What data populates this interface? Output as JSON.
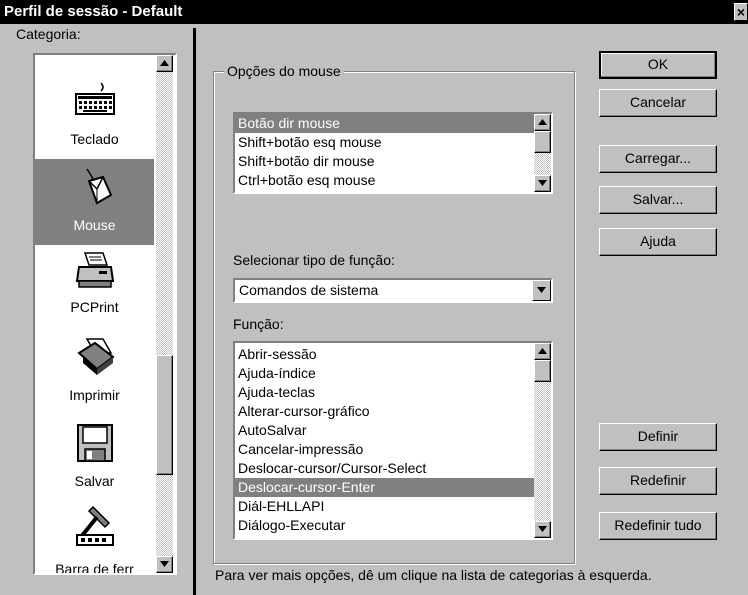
{
  "window": {
    "title": "Perfil de sessão - Default",
    "close_glyph": "×"
  },
  "sidebar": {
    "label": "Categoria:",
    "items": [
      {
        "label": "Teclado",
        "icon": "keyboard-icon"
      },
      {
        "label": "Mouse",
        "icon": "mouse-icon",
        "selected": true
      },
      {
        "label": "PCPrint",
        "icon": "printer-icon"
      },
      {
        "label": "Imprimir",
        "icon": "print-icon"
      },
      {
        "label": "Salvar",
        "icon": "floppy-disk-icon"
      },
      {
        "label": "Barra de ferr",
        "icon": "toolbar-tools-icon"
      }
    ]
  },
  "mouse_options": {
    "group_label": "Opções do mouse",
    "items": [
      "Botão dir mouse",
      "Shift+botão esq mouse",
      "Shift+botão dir mouse",
      "Ctrl+botão esq mouse"
    ],
    "selected_index": 0
  },
  "function_type": {
    "label": "Selecionar tipo de função:",
    "value": "Comandos de sistema"
  },
  "functions": {
    "label": "Função:",
    "items": [
      "Abrir-sessão",
      "Ajuda-índice",
      "Ajuda-teclas",
      "Alterar-cursor-gráfico",
      "AutoSalvar",
      "Cancelar-impressão",
      "Deslocar-cursor/Cursor-Select",
      "Deslocar-cursor-Enter",
      "Diál-EHLLAPI",
      "Diálogo-Executar"
    ],
    "selected_index": 7
  },
  "buttons": {
    "ok": "OK",
    "cancel": "Cancelar",
    "load": "Carregar...",
    "save": "Salvar...",
    "help": "Ajuda",
    "define": "Definir",
    "redefine": "Redefinir",
    "redefine_all": "Redefinir tudo"
  },
  "footer": {
    "hint": "Para ver mais opções, dê um clique na lista de categorias à esquerda."
  },
  "colors": {
    "window_bg": "#c0c0c0",
    "selection": "#808080",
    "titlebar": "#000000"
  }
}
